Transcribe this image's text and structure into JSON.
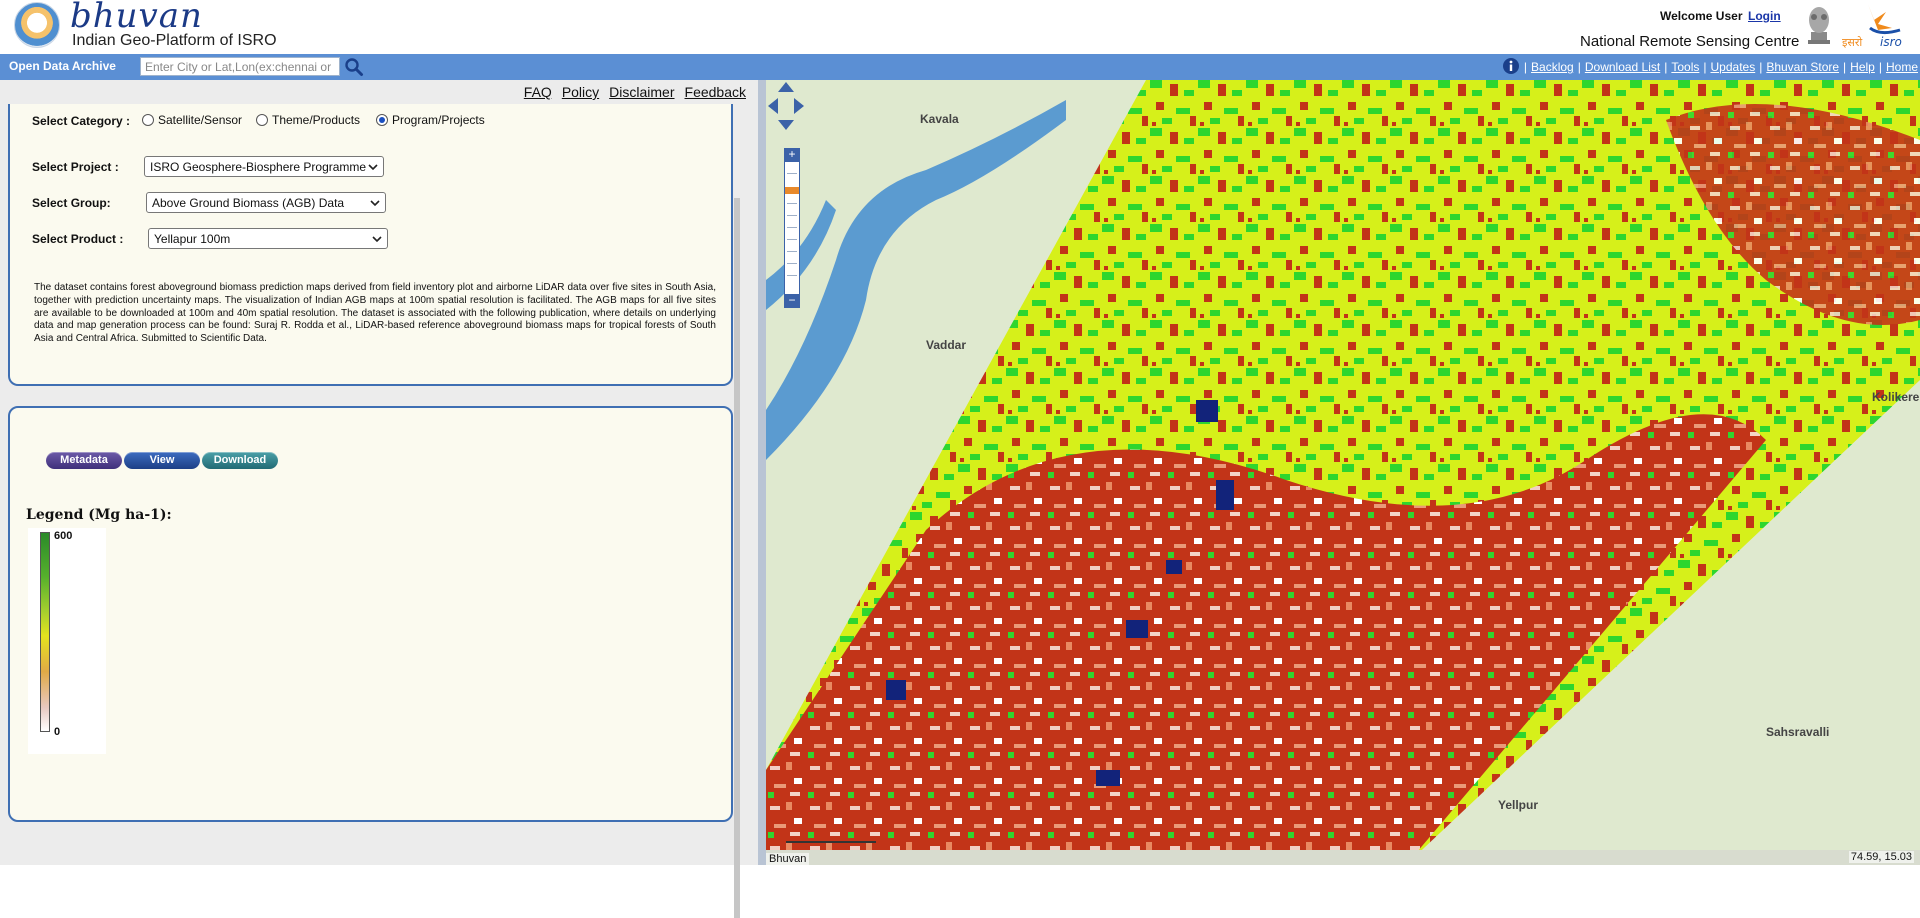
{
  "header": {
    "logo_text": "bhuvan",
    "subtitle": "Indian Geo-Platform of ISRO",
    "welcome": "Welcome User",
    "login": "Login",
    "org": "National Remote Sensing Centre"
  },
  "toolbar": {
    "archive_label": "Open Data Archive",
    "search_placeholder": "Enter City or Lat,Lon(ex:chennai or",
    "links": [
      "Backlog",
      "Download List",
      "Tools",
      "Updates",
      "Bhuvan Store",
      "Help",
      "Home"
    ]
  },
  "footer_links": [
    "FAQ",
    "Policy",
    "Disclaimer",
    "Feedback"
  ],
  "form": {
    "category_label": "Select Category :",
    "categories": [
      {
        "label": "Satellite/Sensor",
        "selected": false
      },
      {
        "label": "Theme/Products",
        "selected": false
      },
      {
        "label": "Program/Projects",
        "selected": true
      }
    ],
    "project_label": "Select Project :",
    "project_value": "ISRO Geosphere-Biosphere Programme",
    "group_label": "Select Group:",
    "group_value": "Above Ground Biomass (AGB) Data",
    "product_label": "Select Product :",
    "product_value": "Yellapur 100m",
    "description": "The dataset contains forest aboveground biomass prediction maps derived from field inventory plot and airborne LiDAR data over five sites in South Asia, together with prediction uncertainty maps. The visualization of Indian AGB maps at 100m spatial resolution is facilitated. The AGB maps for all five sites are available to be downloaded at 100m and 40m spatial resolution. The dataset is associated with the following publication, where details on underlying data and map generation process can be found: Suraj R. Rodda et al., LiDAR-based reference aboveground biomass maps for tropical forests of South Asia and Central Africa. Submitted to Scientific Data."
  },
  "actions": {
    "metadata": "Metadata",
    "view": "View",
    "download": "Download"
  },
  "legend": {
    "title": "Legend (Mg ha-1):",
    "max": "600",
    "min": "0"
  },
  "map": {
    "places": [
      "Kavala",
      "Vaddar",
      "Kolikere",
      "Sahsravalli",
      "Yellpur"
    ],
    "coords": "74.59, 15.03",
    "tag": "Bhuvan",
    "colors": {
      "water": "#5b9bd0",
      "land": "#dfe9cf",
      "high_biomass": "#12237a",
      "green": "#2fcf2f",
      "yellow": "#d8f21a",
      "red": "#c23418",
      "toolbar": "#5b8fd4"
    }
  }
}
